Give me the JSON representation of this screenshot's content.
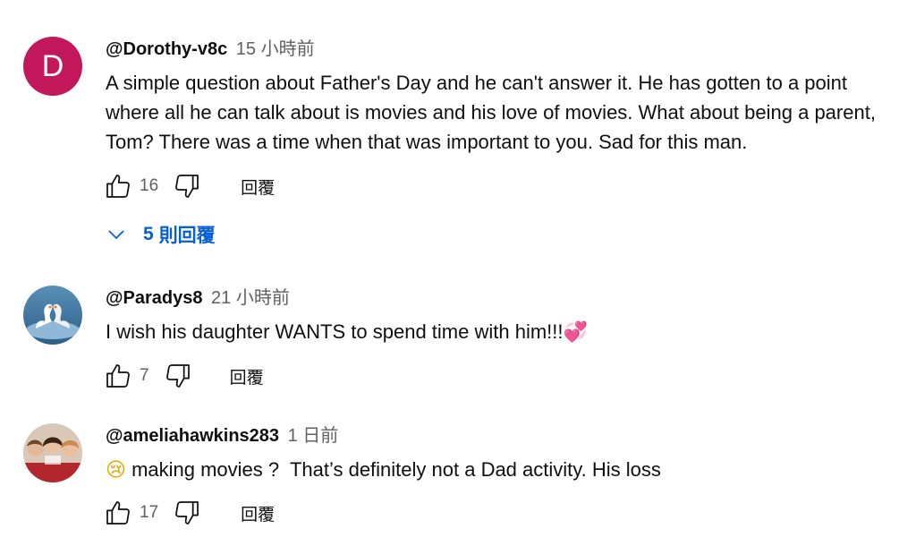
{
  "comments": [
    {
      "author": "@Dorothy-v8c",
      "time": "15 小時前",
      "avatar_letter": "D",
      "text": "A simple question about Father's Day and he can't answer it. He has gotten to a point where all he can talk about is movies and his love of movies. What about being a parent, Tom? There was a time when that was important to you. Sad for this man.",
      "likes": "16",
      "reply_label": "回覆",
      "replies_count": "5",
      "replies_label": "則回覆"
    },
    {
      "author": "@Paradys8",
      "time": "21 小時前",
      "text": "I wish his daughter WANTS to spend time with him!!!",
      "emoji": "💞",
      "likes": "7",
      "reply_label": "回覆"
    },
    {
      "author": "@ameliahawkins283",
      "time": "1 日前",
      "emoji": "😢",
      "text": "making movies ?  That’s definitely not a Dad activity. His loss",
      "likes": "17",
      "reply_label": "回覆"
    }
  ],
  "colors": {
    "link": "#065fd4",
    "meta": "#606060",
    "avatar_d": "#c2185b"
  }
}
